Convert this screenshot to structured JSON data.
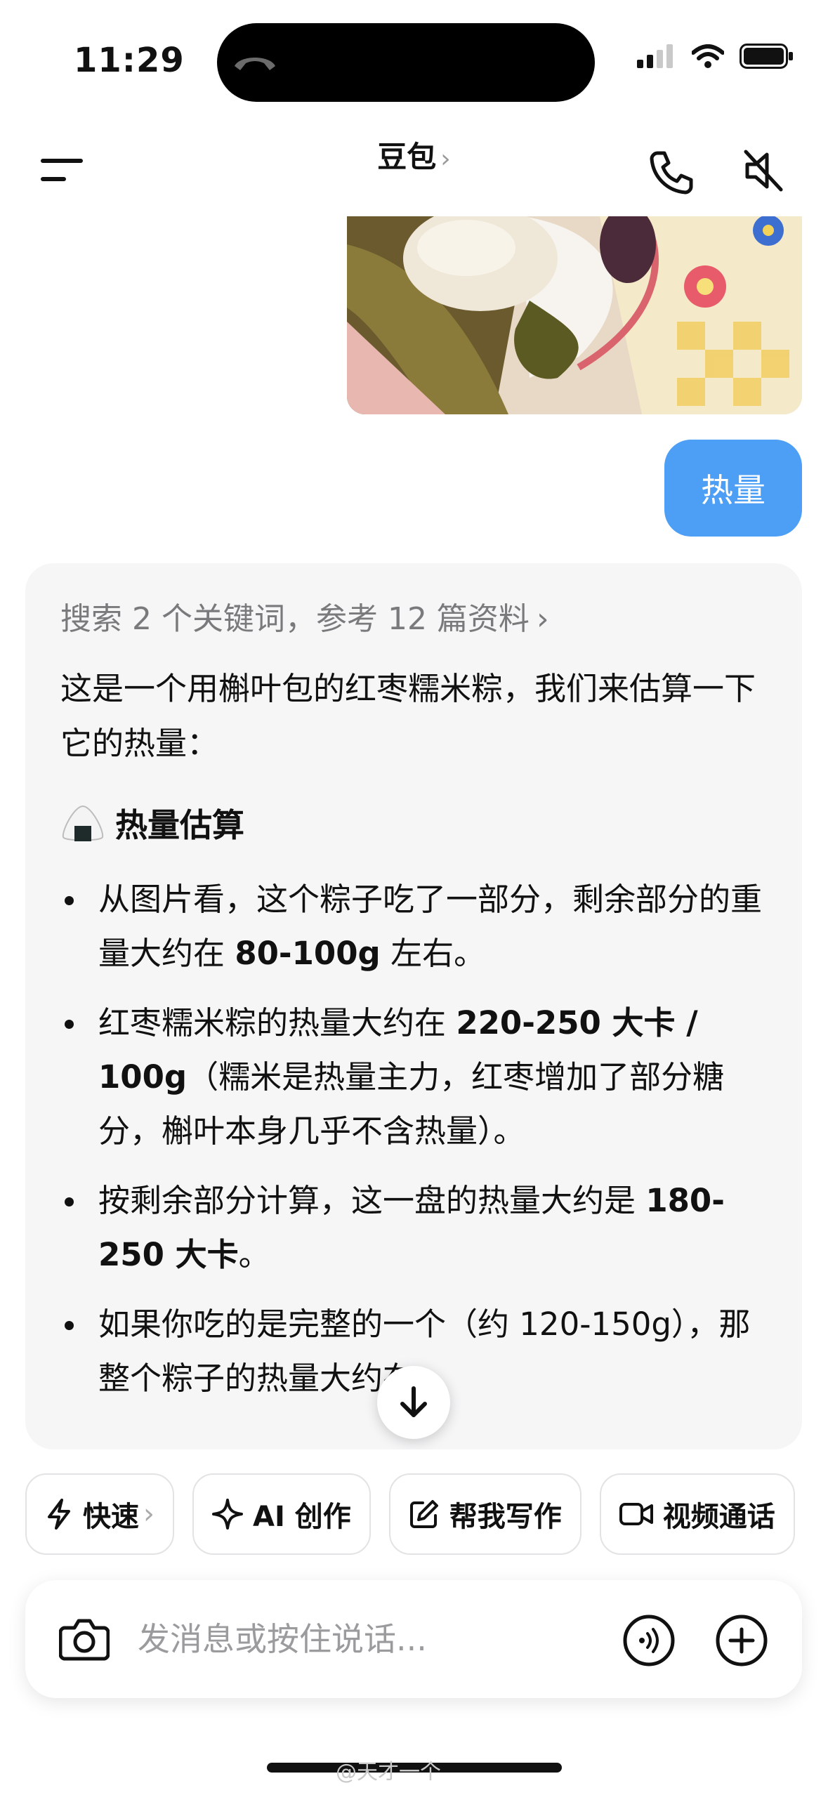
{
  "status_bar": {
    "time": "11:29"
  },
  "header": {
    "title": "豆包",
    "title_chevron": "›"
  },
  "conversation": {
    "user_message": "热量",
    "ai_reply": {
      "search_summary": "搜索 2 个关键词，参考 12 篇资料",
      "search_chevron": "›",
      "intro": "这是一个用槲叶包的红枣糯米粽，我们来估算一下它的热量：",
      "section_title": "热量估算",
      "bullets": [
        {
          "pre": "从图片看，这个粽子吃了一部分，剩余部分的重量大约在 ",
          "bold": "80-100g",
          "post": " 左右。"
        },
        {
          "pre": "红枣糯米粽的热量大约在 ",
          "bold": "220-250 大卡 / 100g",
          "post": "（糯米是热量主力，红枣增加了部分糖分，槲叶本身几乎不含热量）。"
        },
        {
          "pre": "按剩余部分计算，这一盘的热量大约是 ",
          "bold": "180-250 大卡",
          "post": "。"
        },
        {
          "pre": "如果你吃的是完整的一个（约 120-150g），那整个粽子的热量大约在 ",
          "bold": "",
          "post": ""
        }
      ]
    }
  },
  "quick_actions": [
    {
      "label": "快速",
      "icon": "lightning-icon",
      "chevron": "›"
    },
    {
      "label": "AI 创作",
      "icon": "sparkle-icon"
    },
    {
      "label": "帮我写作",
      "icon": "edit-icon"
    },
    {
      "label": "视频通话",
      "icon": "video-camera-icon"
    }
  ],
  "composer": {
    "placeholder": "发消息或按住说话..."
  },
  "watermark": "@天才一个"
}
